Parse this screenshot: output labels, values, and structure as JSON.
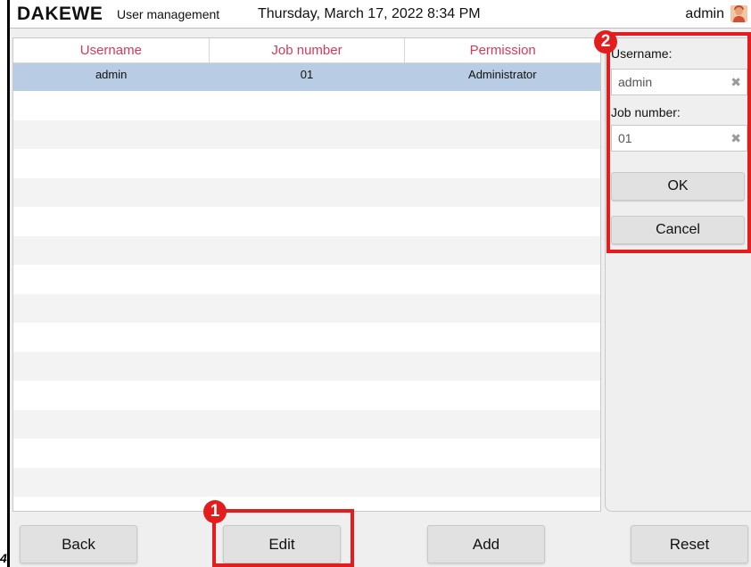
{
  "header": {
    "logo": "DAKEWE",
    "page_name": "User management",
    "datetime": "Thursday, March 17, 2022 8:34 PM",
    "user": "admin"
  },
  "table": {
    "columns": [
      "Username",
      "Job number",
      "Permission"
    ],
    "rows": [
      {
        "username": "admin",
        "job_number": "01",
        "permission": "Administrator",
        "selected": true
      }
    ],
    "empty_rows": 15
  },
  "edit_panel": {
    "username_label": "Username:",
    "username_value": "admin",
    "job_label": "Job number:",
    "job_value": "01",
    "clear_icon": "✖",
    "ok_label": "OK",
    "cancel_label": "Cancel"
  },
  "bottom_bar": {
    "back_label": "Back",
    "edit_label": "Edit",
    "add_label": "Add",
    "reset_label": "Reset"
  },
  "annotations": {
    "step1": "1",
    "step2": "2",
    "stray_mark": "4",
    "highlight_color": "#e31d1d"
  },
  "colors": {
    "header_text": "#d63a5a",
    "selected_row": "#b8cde3"
  }
}
